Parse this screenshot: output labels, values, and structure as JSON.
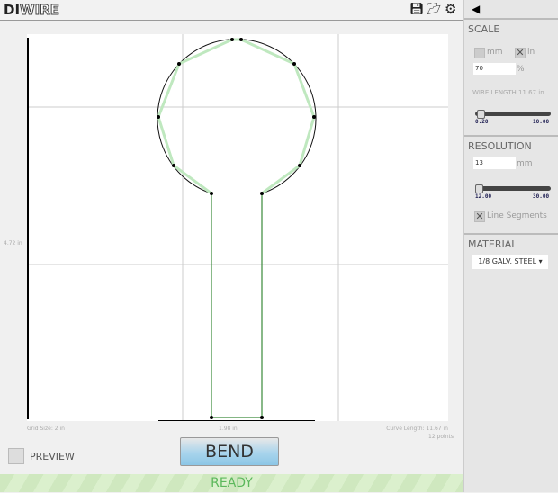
{
  "header": {
    "logo": "DIWIRE",
    "icons": [
      "save-icon",
      "folder-open-icon",
      "gear-icon",
      "collapse-arrow-icon"
    ]
  },
  "canvas": {
    "height_label": "4.72 in",
    "width_label": "1.98 in",
    "grid_size": "Grid Size: 2 in",
    "curve_length": "Curve Length: 11.67 in",
    "points": "12 points"
  },
  "controls": {
    "preview_label": "PREVIEW",
    "bend_label": "BEND",
    "status": "READY"
  },
  "sidebar": {
    "scale": {
      "title": "SCALE",
      "mm_label": "mm",
      "in_label": "in",
      "unit_selected": "in",
      "percent_value": "70",
      "percent_label": "%",
      "wire_length": "WIRE LENGTH 11.67 in",
      "slider_min": "0.20",
      "slider_max": "10.00",
      "slider_fraction": 0.05
    },
    "resolution": {
      "title": "RESOLUTION",
      "value": "13",
      "unit": "mm",
      "slider_min": "12.00",
      "slider_max": "30.00",
      "slider_fraction": 0.03,
      "line_segments_label": "Line Segments",
      "line_segments_checked": true
    },
    "material": {
      "title": "MATERIAL",
      "selected": "1/8 GALV. STEEL"
    }
  }
}
